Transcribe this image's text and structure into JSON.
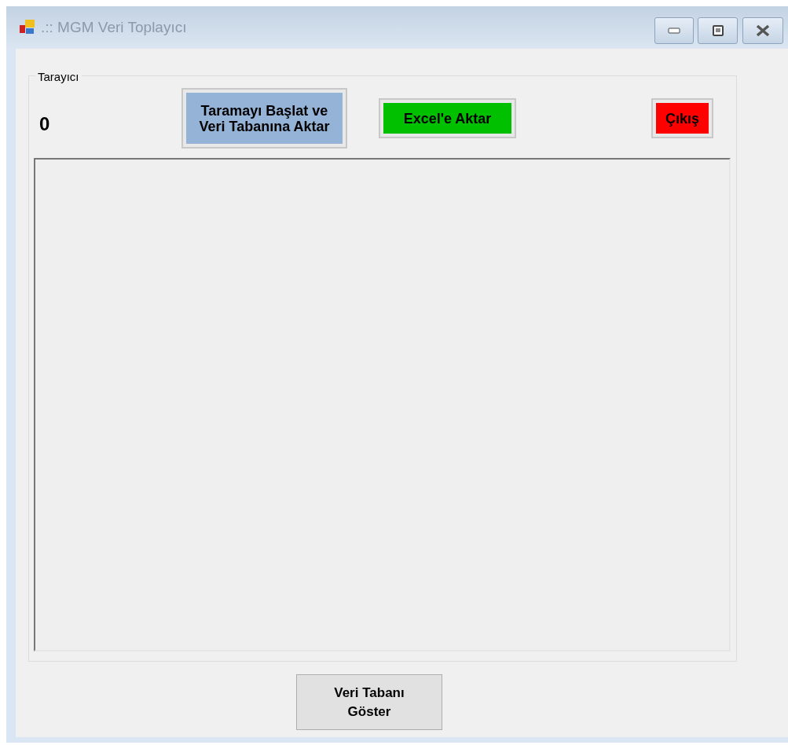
{
  "window": {
    "title": ".:: MGM Veri Toplayıcı"
  },
  "group": {
    "title": "Tarayıcı",
    "counter": "0",
    "buttons": [
      {
        "label": "Taramayı Başlat ve Veri Tabanına Aktar",
        "color": "#95b3d7"
      },
      {
        "label": "Excel'e Aktar",
        "color": "#00c000"
      },
      {
        "label": "Çıkış",
        "color": "#ff0000"
      }
    ]
  },
  "bottom_button": {
    "label": "Veri Tabanı Göster"
  }
}
